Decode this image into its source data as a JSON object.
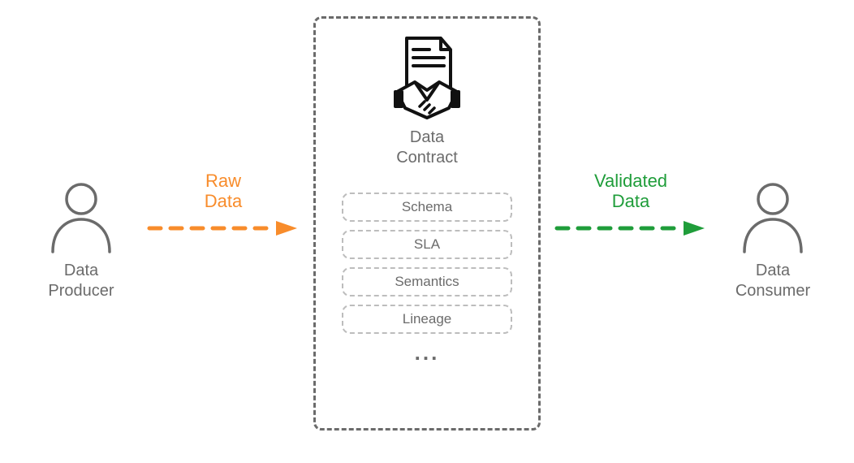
{
  "producer": {
    "label": "Data\nProducer"
  },
  "consumer": {
    "label": "Data\nConsumer"
  },
  "raw_arrow": {
    "label": "Raw\nData",
    "color": "#f88c2b"
  },
  "validated_arrow": {
    "label": "Validated\nData",
    "color": "#1f9d3a"
  },
  "contract": {
    "title": "Data\nContract",
    "components": [
      "Schema",
      "SLA",
      "Semantics",
      "Lineage"
    ],
    "more_indicator": "..."
  }
}
